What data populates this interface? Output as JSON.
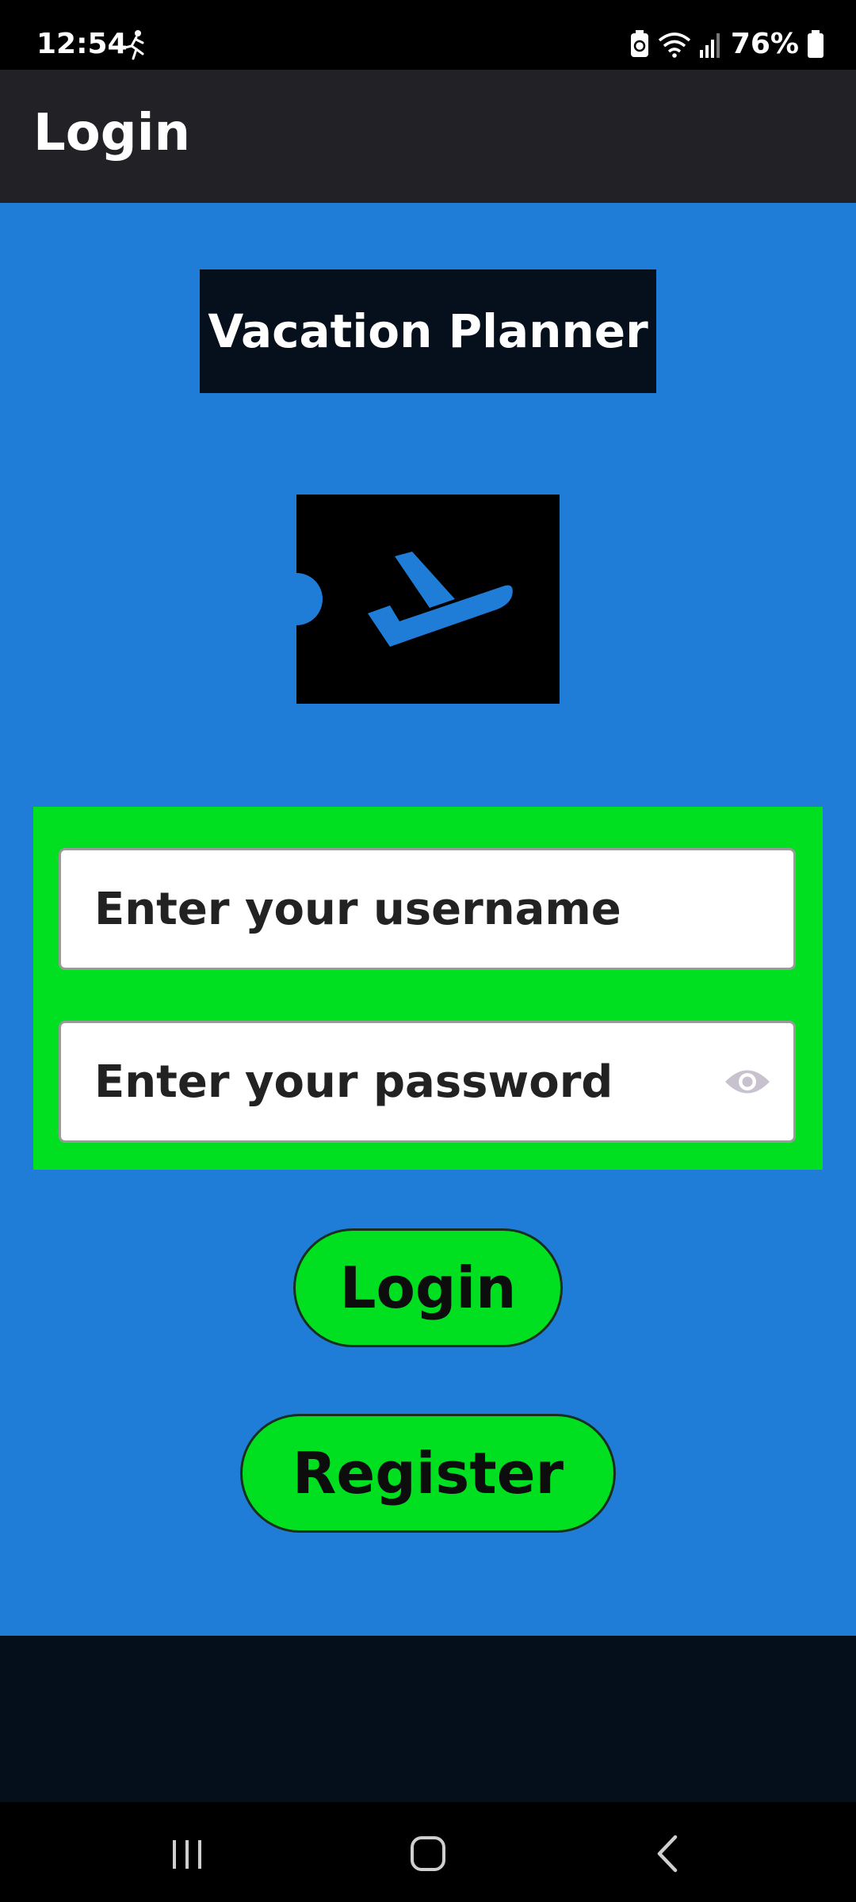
{
  "status_bar": {
    "time": "12:54",
    "battery_percent": "76%",
    "icons": [
      "runner-icon",
      "battery-saver-icon",
      "wifi-icon",
      "signal-icon",
      "battery-icon"
    ]
  },
  "app_bar": {
    "title": "Login"
  },
  "main": {
    "app_name": "Vacation Planner",
    "logo_icon": "airplane-takeoff-icon",
    "username_placeholder": "Enter your username",
    "password_placeholder": "Enter your password",
    "login_button": "Login",
    "register_button": "Register"
  },
  "colors": {
    "content_background": "#1f7dd8",
    "form_panel": "#00e020",
    "button": "#00e020",
    "title_box": "#06101d",
    "app_bar": "#212126"
  },
  "nav_bar": {
    "icons": [
      "recents-icon",
      "home-icon",
      "back-icon"
    ]
  }
}
